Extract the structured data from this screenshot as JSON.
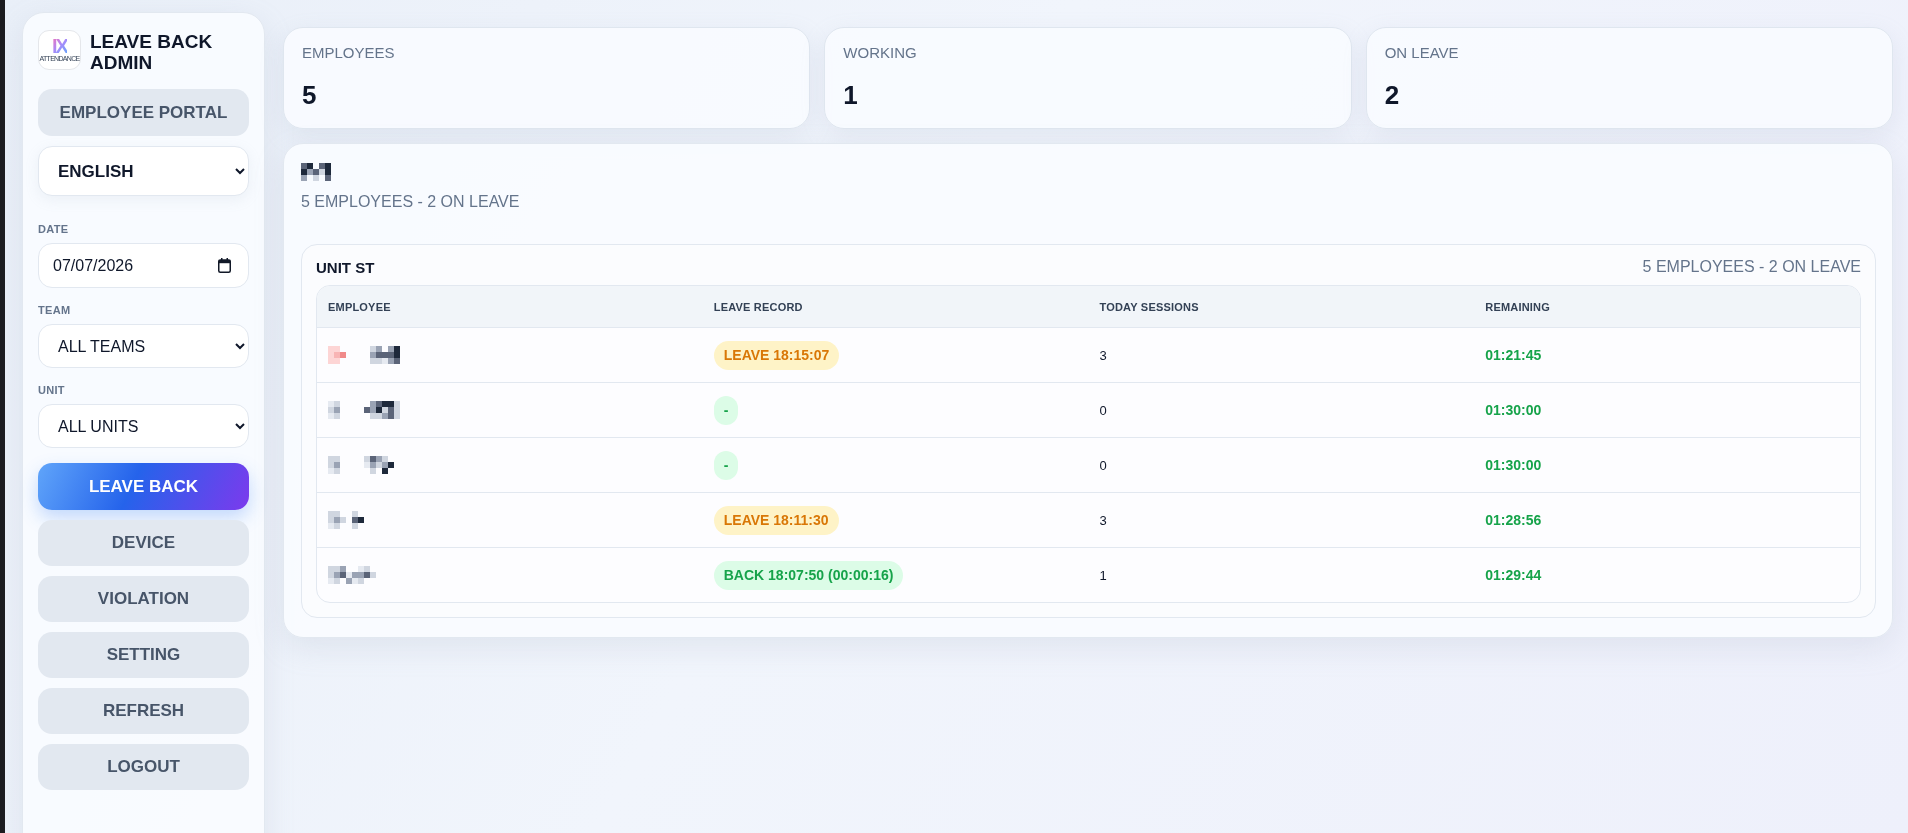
{
  "sidebar": {
    "logo": {
      "mark": "IX",
      "caption": "ATTENDANCE"
    },
    "title": "LEAVE BACK ADMIN",
    "portal_button": "EMPLOYEE PORTAL",
    "language": {
      "value": "ENGLISH"
    },
    "filters": [
      {
        "kind": "date",
        "label": "DATE",
        "value": "07/07/2026"
      },
      {
        "kind": "select",
        "label": "TEAM",
        "value": "ALL TEAMS"
      },
      {
        "kind": "select",
        "label": "UNIT",
        "value": "ALL UNITS"
      }
    ],
    "nav": [
      {
        "label": "LEAVE BACK",
        "selected": true
      },
      {
        "label": "DEVICE",
        "selected": false
      },
      {
        "label": "VIOLATION",
        "selected": false
      },
      {
        "label": "SETTING",
        "selected": false
      },
      {
        "label": "REFRESH",
        "selected": false
      },
      {
        "label": "LOGOUT",
        "selected": false
      }
    ]
  },
  "stats": [
    {
      "label": "EMPLOYEES",
      "value": "5"
    },
    {
      "label": "WORKING",
      "value": "1"
    },
    {
      "label": "ON LEAVE",
      "value": "2"
    }
  ],
  "panel": {
    "subtitle": "5 EMPLOYEES - 2 ON LEAVE",
    "unit": {
      "name": "UNIT ST",
      "summary": "5 EMPLOYEES - 2 ON LEAVE",
      "table": {
        "columns": [
          "EMPLOYEE",
          "LEAVE RECORD",
          "TODAY SESSIONS",
          "REMAINING"
        ],
        "rows": [
          {
            "leave_record": {
              "kind": "leave",
              "text": "LEAVE 18:15:07"
            },
            "today_sessions": "3",
            "remaining": "01:21:45"
          },
          {
            "leave_record": {
              "kind": "none",
              "text": "-"
            },
            "today_sessions": "0",
            "remaining": "01:30:00"
          },
          {
            "leave_record": {
              "kind": "none",
              "text": "-"
            },
            "today_sessions": "0",
            "remaining": "01:30:00"
          },
          {
            "leave_record": {
              "kind": "leave",
              "text": "LEAVE 18:11:30"
            },
            "today_sessions": "3",
            "remaining": "01:28:56"
          },
          {
            "leave_record": {
              "kind": "back",
              "text": "BACK 18:07:50 (00:00:16)"
            },
            "today_sessions": "1",
            "remaining": "01:29:44"
          }
        ]
      }
    }
  }
}
